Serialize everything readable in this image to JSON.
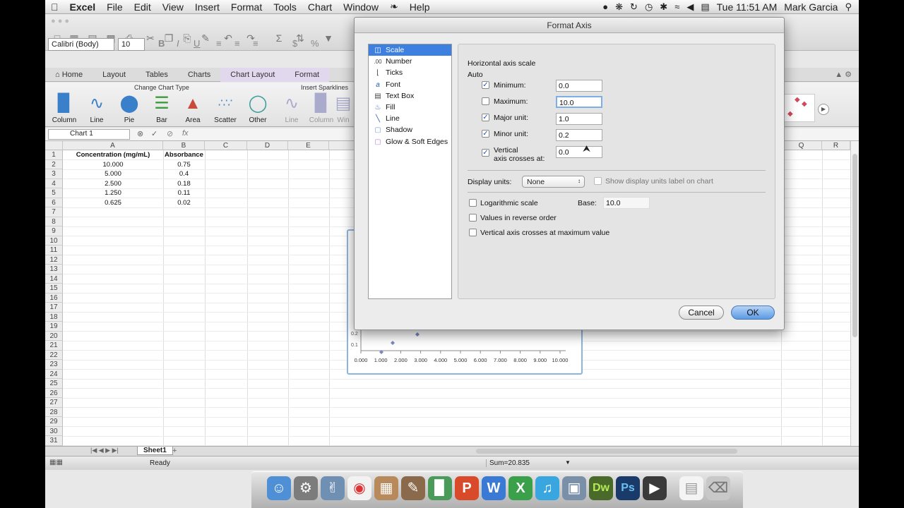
{
  "menubar": {
    "app": "Excel",
    "items": [
      "File",
      "Edit",
      "View",
      "Insert",
      "Format",
      "Tools",
      "Chart",
      "Window",
      "Help"
    ],
    "clock": "Tue 11:51 AM",
    "user": "Mark Garcia"
  },
  "toolbar": {
    "font_name": "Calibri (Body)",
    "font_size": "10"
  },
  "ribbon": {
    "tabs": [
      "Home",
      "Layout",
      "Tables",
      "Charts",
      "Chart Layout",
      "Format"
    ],
    "group_change_chart_type": "Change Chart Type",
    "group_insert_sparklines": "Insert Sparklines",
    "chart_buttons": [
      "Column",
      "Line",
      "Pie",
      "Bar",
      "Area",
      "Scatter",
      "Other"
    ],
    "sparkline_buttons": [
      "Line",
      "Column",
      "Win"
    ]
  },
  "formula_bar": {
    "name_box": "Chart 1",
    "fx": "fx"
  },
  "sheet": {
    "columns": [
      "A",
      "B",
      "C",
      "D",
      "E",
      "Q",
      "R"
    ],
    "rows": [
      "1",
      "2",
      "3",
      "4",
      "5",
      "6",
      "7",
      "8",
      "9",
      "10",
      "11",
      "12",
      "13",
      "14",
      "15",
      "16",
      "17",
      "18",
      "19",
      "20",
      "21",
      "22",
      "23",
      "24",
      "25",
      "26",
      "27",
      "28",
      "29",
      "30",
      "31"
    ],
    "headers": [
      "Concentration (mg/mL)",
      "Absorbance"
    ],
    "data": [
      [
        "10.000",
        "0.75"
      ],
      [
        "5.000",
        "0.4"
      ],
      [
        "2.500",
        "0.18"
      ],
      [
        "1.250",
        "0.11"
      ],
      [
        "0.625",
        "0.02"
      ]
    ],
    "tab": "Sheet1"
  },
  "chart": {
    "x_ticks": [
      "0.000",
      "1.000",
      "2.000",
      "3.000",
      "4.000",
      "5.000",
      "6.000",
      "7.000",
      "8.000",
      "9.000",
      "10.000"
    ],
    "y_ticks": [
      "0.2",
      "0.1"
    ]
  },
  "status": {
    "ready": "Ready",
    "sum": "Sum=20.835"
  },
  "dialog": {
    "title": "Format Axis",
    "categories": [
      "Scale",
      "Number",
      "Ticks",
      "Font",
      "Text Box",
      "Fill",
      "Line",
      "Shadow",
      "Glow & Soft Edges"
    ],
    "category_icons": [
      "scale-icon",
      "number-icon",
      "ticks-icon",
      "font-icon",
      "text-box-icon",
      "fill-icon",
      "line-icon",
      "shadow-icon",
      "glow-icon"
    ],
    "section_title": "Horizontal axis scale",
    "auto_label": "Auto",
    "fields": {
      "minimum": {
        "label": "Minimum:",
        "value": "0.0",
        "checked": true
      },
      "maximum": {
        "label": "Maximum:",
        "value": "10.0",
        "checked": false
      },
      "major": {
        "label": "Major unit:",
        "value": "1.0",
        "checked": true
      },
      "minor": {
        "label": "Minor unit:",
        "value": "0.2",
        "checked": true
      },
      "crosses_line1": "Vertical",
      "crosses_line2": "axis crosses at:",
      "crosses_value": "0.0"
    },
    "display_units_label": "Display units:",
    "display_units_value": "None",
    "show_units_label": "Show display units label on chart",
    "log_label": "Logarithmic scale",
    "base_label": "Base:",
    "base_value": "10.0",
    "reverse_label": "Values in reverse order",
    "max_cross_label": "Vertical axis crosses at maximum value",
    "cancel": "Cancel",
    "ok": "OK"
  },
  "dock": {
    "apps": [
      "finder-icon",
      "system-prefs-icon",
      "preview-icon",
      "chrome-icon",
      "keynote-icon",
      "script-icon",
      "charts-icon",
      "powerpoint-icon",
      "word-icon",
      "excel-icon",
      "itunes-icon",
      "photos-icon",
      "dreamweaver-icon",
      "photoshop-icon",
      "quicktime-icon",
      "document-icon",
      "trash-icon"
    ],
    "labels": {
      "dw": "Dw",
      "ps": "Ps"
    }
  }
}
